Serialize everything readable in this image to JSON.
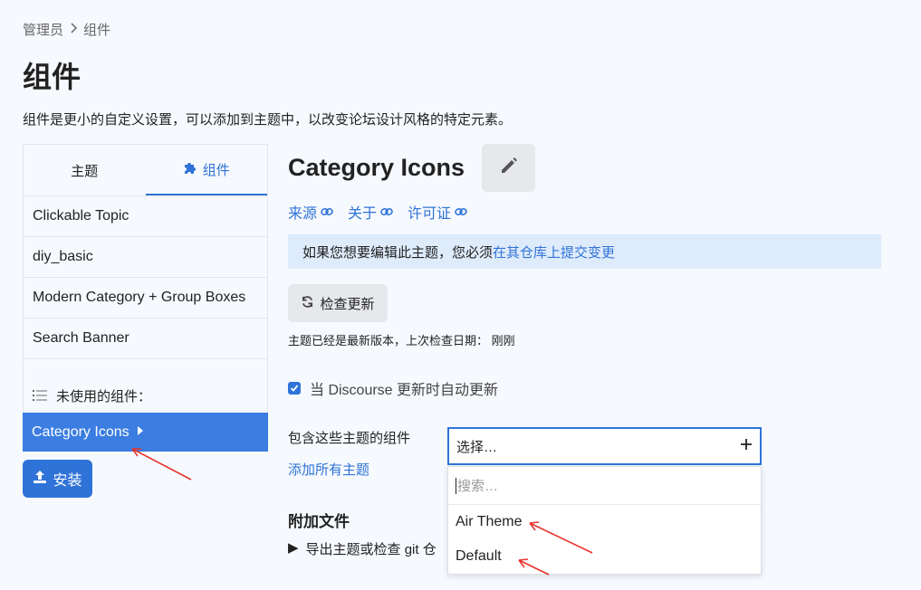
{
  "breadcrumb": {
    "root": "管理员",
    "current": "组件"
  },
  "page": {
    "title": "组件",
    "description": "组件是更小的自定义设置，可以添加到主题中，以改变论坛设计风格的特定元素。"
  },
  "sidebar": {
    "tabs": [
      {
        "label": "主题",
        "active": false
      },
      {
        "label": "组件",
        "active": true,
        "icon": "puzzle-icon"
      }
    ],
    "components": [
      "Clickable Topic",
      "diy_basic",
      "Modern Category + Group Boxes",
      "Search Banner"
    ],
    "unused_label": "未使用的组件：",
    "selected": "Category Icons",
    "install_label": "安装"
  },
  "detail": {
    "title": "Category Icons",
    "links": [
      "来源",
      "关于",
      "许可证"
    ],
    "notice_prefix": "如果您想要编辑此主题，您必须",
    "notice_link": "在其仓库上提交变更",
    "check_label": "检查更新",
    "check_status": "主题已经是最新版本，上次检查日期： 刚刚",
    "auto_update_label": "当 Discourse 更新时自动更新",
    "include_label": "包含这些主题的组件",
    "add_all_label": "添加所有主题",
    "select_placeholder": "选择…",
    "search_placeholder": "搜索…",
    "options": [
      "Air Theme",
      "Default"
    ],
    "files_heading": "附加文件",
    "export_label": "导出主题或检查 git 仓"
  },
  "colors": {
    "accent": "#2f73d8",
    "selected_bg": "#3b7de0",
    "annotation": "#e8342c"
  }
}
